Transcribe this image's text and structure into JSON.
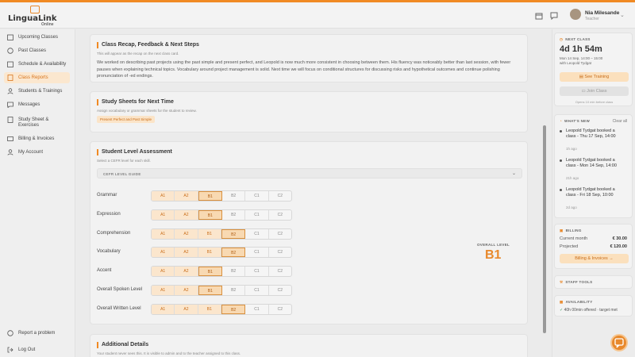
{
  "app": {
    "name": "LinguaLink",
    "sub": "Online"
  },
  "user": {
    "name": "Nia Milesande",
    "role": "Teacher"
  },
  "sidebar": {
    "items": [
      {
        "label": "Upcoming Classes"
      },
      {
        "label": "Past Classes"
      },
      {
        "label": "Schedule & Availability"
      },
      {
        "label": "Class Reports"
      },
      {
        "label": "Students & Trainings"
      },
      {
        "label": "Messages"
      },
      {
        "label": "Study Sheet &"
      },
      {
        "label": "Billing & Invoices"
      },
      {
        "label": "My Account"
      }
    ],
    "item6b": "Exercises",
    "report": "Report a problem",
    "logout": "Log Out"
  },
  "recap": {
    "title": "Class Recap, Feedback & Next Steps",
    "subtitle": "This will appear as the recap on the next class card.",
    "text": "We worked on describing past projects using the past simple and present perfect, and Leopold is now much more consistent in choosing between them. His fluency was noticeably better than last session, with fewer pauses when explaining technical topics. Vocabulary around project management is solid. Next time we will focus on conditional structures for discussing risks and hypothetical outcomes and continue polishing pronunciation of -ed endings."
  },
  "study": {
    "title": "Study Sheets for Next Time",
    "subtitle": "Assign vocabulary or grammar sheets for the student to review.",
    "tag": "Present Perfect and Past Simple"
  },
  "assessment": {
    "title": "Student Level Assessment",
    "subtitle": "Select a CEFR level for each skill.",
    "guide": "CEFR LEVEL GUIDE",
    "levels": [
      "A1",
      "A2",
      "B1",
      "B2",
      "C1",
      "C2"
    ],
    "skills": [
      {
        "label": "Grammar",
        "level": "B1"
      },
      {
        "label": "Expression",
        "level": "B1"
      },
      {
        "label": "Comprehension",
        "level": "B2"
      },
      {
        "label": "Vocabulary",
        "level": "B2"
      },
      {
        "label": "Accent",
        "level": "B1"
      },
      {
        "label": "Overall Spoken Level",
        "level": "B1"
      },
      {
        "label": "Overall Written Level",
        "level": "B2"
      }
    ],
    "overall_label": "OVERALL LEVEL",
    "overall_value": "B1"
  },
  "additional": {
    "title": "Additional Details",
    "subtitle": "Your student never sees this. It is visible to admin and to the teacher assigned to this class."
  },
  "next_class": {
    "header": "NEXT CLASS",
    "countdown": "4d 1h 54m",
    "when": "Mon 14 Sep, 14:00 – 15:00",
    "with": "with Leopold Tydgat",
    "see_training": "See Training",
    "join": "Join Class",
    "note": "Opens 10 min before class"
  },
  "whats_new": {
    "header": "WHAT'S NEW",
    "clear": "Clear all",
    "items": [
      {
        "text": "Leopold Tydgat booked a class - Thu 17 Sep, 14:00",
        "ago": "1h ago"
      },
      {
        "text": "Leopold Tydgat booked a class - Mon 14 Sep, 14:00",
        "ago": "21h ago"
      },
      {
        "text": "Leopold Tydgat booked a class - Fri 18 Sep, 10:00",
        "ago": "2d ago"
      }
    ]
  },
  "billing": {
    "header": "BILLING",
    "current_label": "Current month",
    "current_value": "€ 30.00",
    "projected_label": "Projected",
    "projected_value": "€ 120.00",
    "button": "Billing & Invoices"
  },
  "staff": {
    "header": "STAFF TOOLS"
  },
  "availability": {
    "header": "AVAILABILITY",
    "text": "40h 00min offered · target met"
  },
  "colors": {
    "accent": "#f08a24",
    "accent_light": "#fbe6cd"
  }
}
